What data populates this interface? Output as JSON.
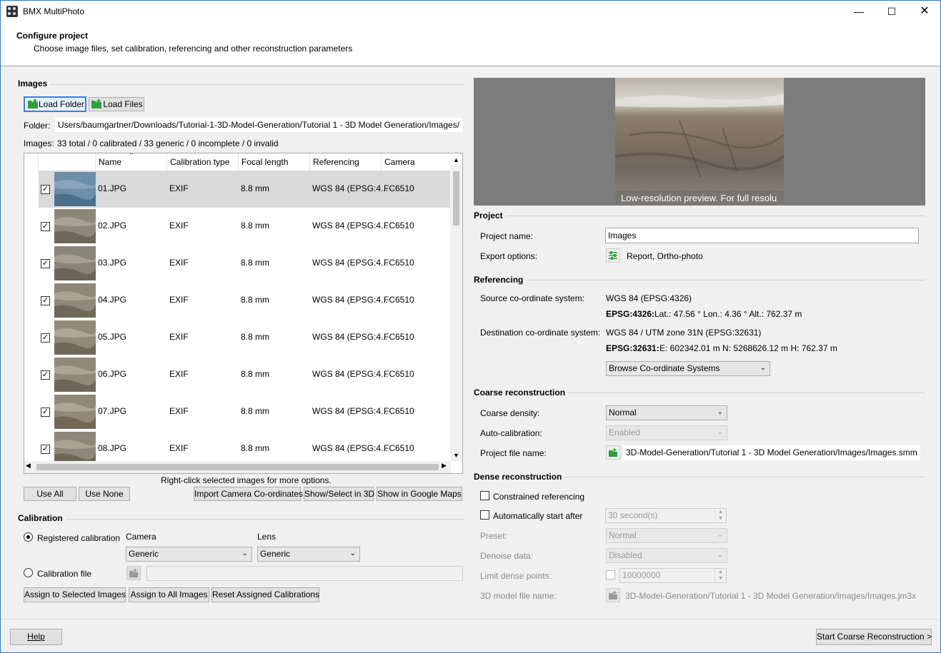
{
  "window": {
    "title": "BMX MultiPhoto"
  },
  "header": {
    "title": "Configure project",
    "subtitle": "Choose image files, set calibration, referencing and other reconstruction parameters"
  },
  "images": {
    "section_title": "Images",
    "load_folder_label": "Load Folder",
    "load_files_label": "Load Files",
    "folder_label": "Folder:",
    "folder_path": "/Users/baumgartner/Downloads/Tutorial-1-3D-Model-Generation/Tutorial 1 - 3D Model Generation/Images",
    "images_label": "Images:",
    "images_summary": "33 total / 0 calibrated / 33 generic / 0 incomplete / 0 invalid",
    "columns": [
      "Name",
      "Calibration type",
      "Focal length",
      "Referencing",
      "Camera"
    ],
    "rows": [
      {
        "name": "01.JPG",
        "calibration": "EXIF",
        "focal": "8.8 mm",
        "referencing": "WGS 84 (EPSG:4...",
        "camera": "FC6510",
        "checked": true,
        "selected": true
      },
      {
        "name": "02.JPG",
        "calibration": "EXIF",
        "focal": "8.8 mm",
        "referencing": "WGS 84 (EPSG:4...",
        "camera": "FC6510",
        "checked": true,
        "selected": false
      },
      {
        "name": "03.JPG",
        "calibration": "EXIF",
        "focal": "8.8 mm",
        "referencing": "WGS 84 (EPSG:4...",
        "camera": "FC6510",
        "checked": true,
        "selected": false
      },
      {
        "name": "04.JPG",
        "calibration": "EXIF",
        "focal": "8.8 mm",
        "referencing": "WGS 84 (EPSG:4...",
        "camera": "FC6510",
        "checked": true,
        "selected": false
      },
      {
        "name": "05.JPG",
        "calibration": "EXIF",
        "focal": "8.8 mm",
        "referencing": "WGS 84 (EPSG:4...",
        "camera": "FC6510",
        "checked": true,
        "selected": false
      },
      {
        "name": "06.JPG",
        "calibration": "EXIF",
        "focal": "8.8 mm",
        "referencing": "WGS 84 (EPSG:4...",
        "camera": "FC6510",
        "checked": true,
        "selected": false
      },
      {
        "name": "07.JPG",
        "calibration": "EXIF",
        "focal": "8.8 mm",
        "referencing": "WGS 84 (EPSG:4...",
        "camera": "FC6510",
        "checked": true,
        "selected": false
      },
      {
        "name": "08.JPG",
        "calibration": "EXIF",
        "focal": "8.8 mm",
        "referencing": "WGS 84 (EPSG:4...",
        "camera": "FC6510",
        "checked": true,
        "selected": false
      }
    ],
    "hint": "Right-click selected images for more options.",
    "use_all_label": "Use All",
    "use_none_label": "Use None",
    "import_coords_label": "Import Camera Co-ordinates",
    "show_3d_label": "Show/Select in 3D",
    "google_maps_label": "Show in Google Maps"
  },
  "calibration": {
    "section_title": "Calibration",
    "registered_label": "Registered calibration",
    "camera_label": "Camera",
    "lens_label": "Lens",
    "camera_value": "Generic",
    "lens_value": "Generic",
    "file_label": "Calibration file",
    "file_value": "",
    "assign_selected_label": "Assign to Selected Images",
    "assign_all_label": "Assign to All Images",
    "reset_label": "Reset Assigned Calibrations"
  },
  "preview": {
    "caption": "Low-resolution preview. For full resolu"
  },
  "project": {
    "section_title": "Project",
    "name_label": "Project name:",
    "name_value": "Images",
    "export_label": "Export options:",
    "export_value": "Report, Ortho-photo"
  },
  "referencing": {
    "section_title": "Referencing",
    "source_label": "Source co-ordinate system:",
    "source_value": "WGS 84 (EPSG:4326)",
    "source_code": "EPSG:4326:",
    "source_coords": "Lat.: 47.56 °  Lon.: 4.36 °  Alt.: 762.37 m",
    "dest_label": "Destination co-ordinate system:",
    "dest_value": "WGS 84 / UTM zone 31N (EPSG:32631)",
    "dest_code": "EPSG:32631:",
    "dest_coords": "E: 602342.01 m  N: 5268626.12 m  H: 762.37 m",
    "browse_value": "Browse Co-ordinate Systems"
  },
  "coarse": {
    "section_title": "Coarse reconstruction",
    "density_label": "Coarse density:",
    "density_value": "Normal",
    "autocal_label": "Auto-calibration:",
    "autocal_value": "Enabled",
    "file_label": "Project file name:",
    "file_value": "3D-Model-Generation/Tutorial 1 - 3D Model Generation/Images/Images.smm"
  },
  "dense": {
    "section_title": "Dense reconstruction",
    "constrained_label": "Constrained referencing",
    "auto_start_label": "Automatically start after",
    "auto_start_value": "30 second(s)",
    "preset_label": "Preset:",
    "preset_value": "Normal",
    "denoise_label": "Denoise data:",
    "denoise_value": "Disabled",
    "limit_label": "Limit dense points:",
    "limit_value": "10000000",
    "model_file_label": "3D model file name:",
    "model_file_value": "3D-Model-Generation/Tutorial 1 - 3D Model Generation/Images/Images.jm3x"
  },
  "footer": {
    "help_label": "Help",
    "start_label": "Start Coarse Reconstruction >"
  },
  "colors": {
    "accent": "#2b79d0",
    "folder_green": "#2e9e3e",
    "selected_row": "#d9d9d9"
  }
}
